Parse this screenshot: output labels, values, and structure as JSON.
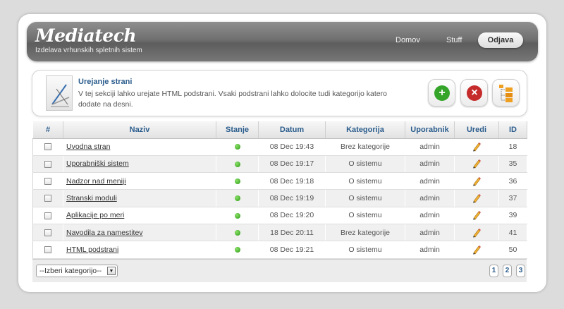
{
  "header": {
    "logo": "Mediatech",
    "tagline": "Izdelava vrhunskih spletnih sistem",
    "nav": {
      "home": "Domov",
      "stuff": "Stuff",
      "logout": "Odjava"
    }
  },
  "info": {
    "title": "Urejanje strani",
    "description": "V tej sekciji lahko urejate HTML podstrani. Vsaki podstrani lahko dolocite tudi kategorijo katero dodate na desni.",
    "buttons": {
      "add": "+",
      "delete": "×"
    },
    "colors": {
      "add": "#35a52a",
      "delete": "#c62b2b"
    }
  },
  "table": {
    "columns": [
      "#",
      "Naziv",
      "Stanje",
      "Datum",
      "Kategorija",
      "Uporabnik",
      "Uredi",
      "ID"
    ],
    "rows": [
      {
        "name": "Uvodna stran",
        "date": "08 Dec 19:43",
        "category": "Brez kategorije",
        "user": "admin",
        "id": "18"
      },
      {
        "name": "Uporabniški sistem",
        "date": "08 Dec 19:17",
        "category": "O sistemu",
        "user": "admin",
        "id": "35"
      },
      {
        "name": "Nadzor nad meniji",
        "date": "08 Dec 19:18",
        "category": "O sistemu",
        "user": "admin",
        "id": "36"
      },
      {
        "name": "Stranski moduli",
        "date": "08 Dec 19:19",
        "category": "O sistemu",
        "user": "admin",
        "id": "37"
      },
      {
        "name": "Aplikacije po meri",
        "date": "08 Dec 19:20",
        "category": "O sistemu",
        "user": "admin",
        "id": "39"
      },
      {
        "name": "Navodila za namestitev",
        "date": "18 Dec 20:11",
        "category": "Brez kategorije",
        "user": "admin",
        "id": "41"
      },
      {
        "name": "HTML podstrani",
        "date": "08 Dec 19:21",
        "category": "O sistemu",
        "user": "admin",
        "id": "50"
      }
    ]
  },
  "footer": {
    "category_select": "--Izberi kategorijo--",
    "pages": [
      "1",
      "2",
      "3"
    ]
  }
}
